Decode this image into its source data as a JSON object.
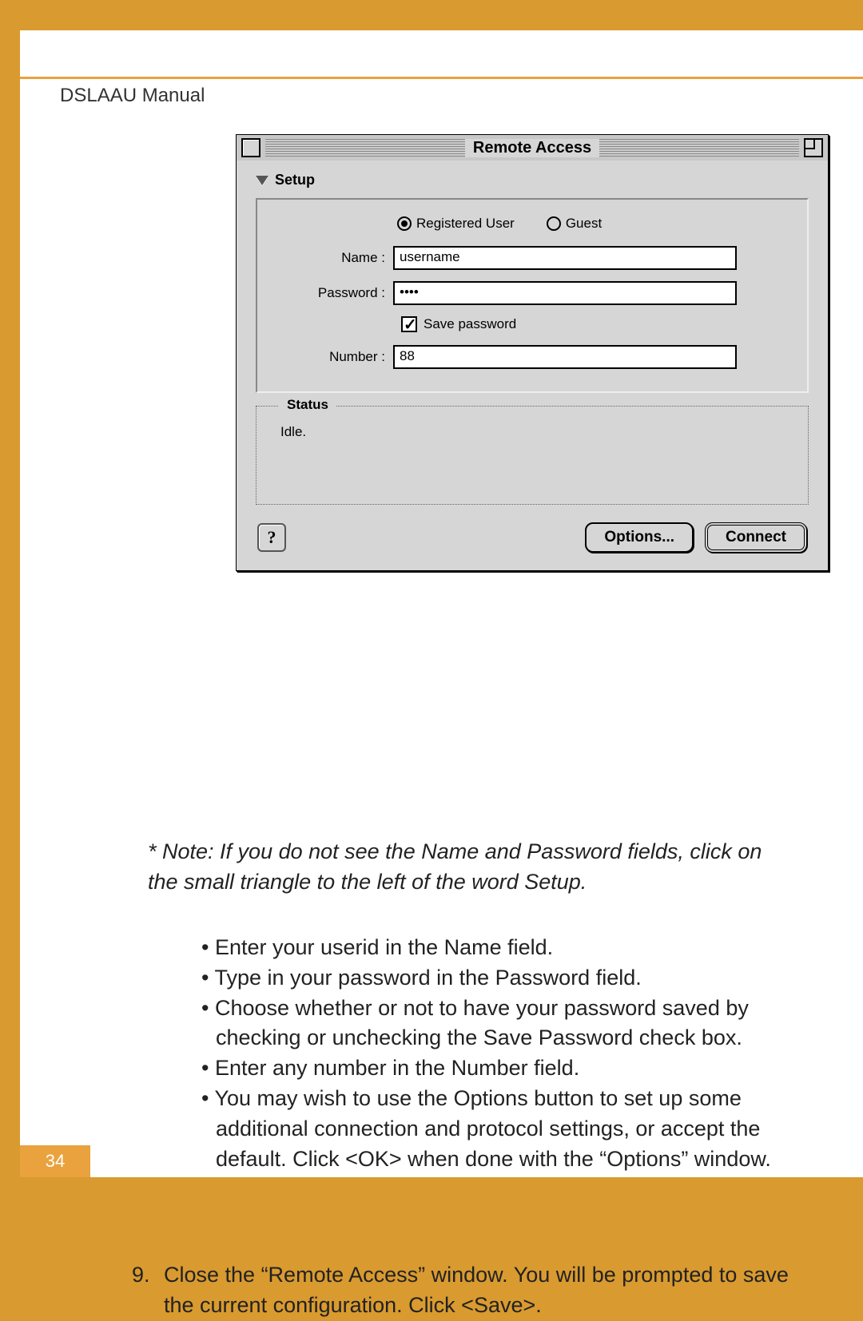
{
  "manual_title": "DSLAAU Manual",
  "page_number": "34",
  "window": {
    "title": "Remote Access",
    "setup_label": "Setup",
    "radios": {
      "registered": "Registered User",
      "guest": "Guest"
    },
    "labels": {
      "name": "Name :",
      "password": "Password :",
      "number": "Number :"
    },
    "name_value": "username",
    "password_value": "••••",
    "save_password": "Save password",
    "number_value": "88",
    "status_label": "Status",
    "status_text": "Idle.",
    "help_glyph": "?",
    "options_btn": "Options...",
    "connect_btn": "Connect"
  },
  "note": "* Note: If you do not see the Name and Password fields, click on the small triangle to the left of the word Setup.",
  "bullets": [
    "Enter your userid in the Name field.",
    "Type in your password in the Password field.",
    "Choose whether or not to have your password saved by checking or unchecking the Save Password check box.",
    "Enter any number in the Number field.",
    "You may wish to use the Options button to set up some additional connection and protocol settings, or accept the default. Click <OK> when done with the “Options” window."
  ],
  "step9_num": "9.",
  "step9": "Close the “Remote Access” window. You will be prompted to save the current configuration. Click <Save>."
}
